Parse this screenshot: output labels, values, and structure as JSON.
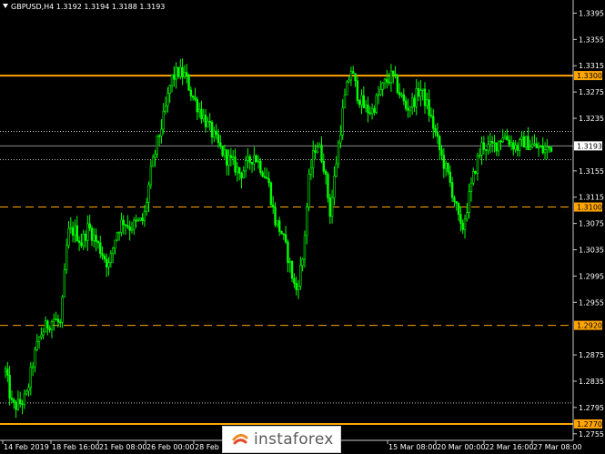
{
  "header": {
    "symbol_line": "GBPUSD,H4  1.3192 1.3194 1.3188 1.3193"
  },
  "watermark": {
    "text": "instaforex"
  },
  "colors": {
    "background": "#000000",
    "candle": "#00ff00",
    "level": "#ffa500",
    "price_line": "#8c8c8c",
    "text": "#ffffff"
  },
  "chart_data": {
    "type": "candlestick",
    "symbol": "GBPUSD",
    "timeframe": "H4",
    "ohlc_last": {
      "open": 1.3192,
      "high": 1.3194,
      "low": 1.3188,
      "close": 1.3193
    },
    "current_price": "1.3193",
    "ylim": [
      1.2745,
      1.3415
    ],
    "y_ticks": [
      "1.3395",
      "1.3355",
      "1.3315",
      "1.3275",
      "1.3235",
      "1.3155",
      "1.3115",
      "1.3075",
      "1.3035",
      "1.2995",
      "1.2955",
      "1.2875",
      "1.2835",
      "1.2795",
      "1.2755"
    ],
    "x_ticks": [
      "14 Feb 2019",
      "18 Feb 16:00",
      "21 Feb 08:00",
      "26 Feb 00:00",
      "28 Feb",
      "15 Mar 08:00",
      "20 Mar 00:00",
      "22 Mar 16:00",
      "27 Mar 08:00"
    ],
    "levels": [
      {
        "price": 1.33,
        "label": "1.3300",
        "style": "solid"
      },
      {
        "price": 1.31,
        "label": "1.3100",
        "style": "dashed"
      },
      {
        "price": 1.292,
        "label": "1.2920",
        "style": "dashed"
      },
      {
        "price": 1.277,
        "label": "1.2770",
        "style": "solid"
      }
    ],
    "dotted_lines": [
      1.3215,
      1.3172,
      1.2802
    ],
    "series": [
      {
        "name": "GBPUSD",
        "close": [
          1.285,
          1.2795,
          1.28,
          1.281,
          1.2865,
          1.2905,
          1.292,
          1.293,
          1.292,
          1.306,
          1.3065,
          1.3045,
          1.307,
          1.305,
          1.303,
          1.301,
          1.306,
          1.308,
          1.307,
          1.3075,
          1.308,
          1.315,
          1.32,
          1.324,
          1.3295,
          1.3305,
          1.33,
          1.327,
          1.325,
          1.323,
          1.321,
          1.319,
          1.3175,
          1.3165,
          1.315,
          1.3165,
          1.318,
          1.316,
          1.314,
          1.308,
          1.306,
          1.302,
          1.297,
          1.302,
          1.315,
          1.32,
          1.317,
          1.309,
          1.318,
          1.326,
          1.331,
          1.327,
          1.325,
          1.3245,
          1.327,
          1.329,
          1.33,
          1.3275,
          1.325,
          1.326,
          1.328,
          1.3255,
          1.322,
          1.318,
          1.315,
          1.311,
          1.306,
          1.311,
          1.316,
          1.3195,
          1.319,
          1.3195,
          1.321,
          1.32,
          1.319,
          1.32,
          1.3195,
          1.319,
          1.3185,
          1.3193
        ]
      }
    ]
  }
}
